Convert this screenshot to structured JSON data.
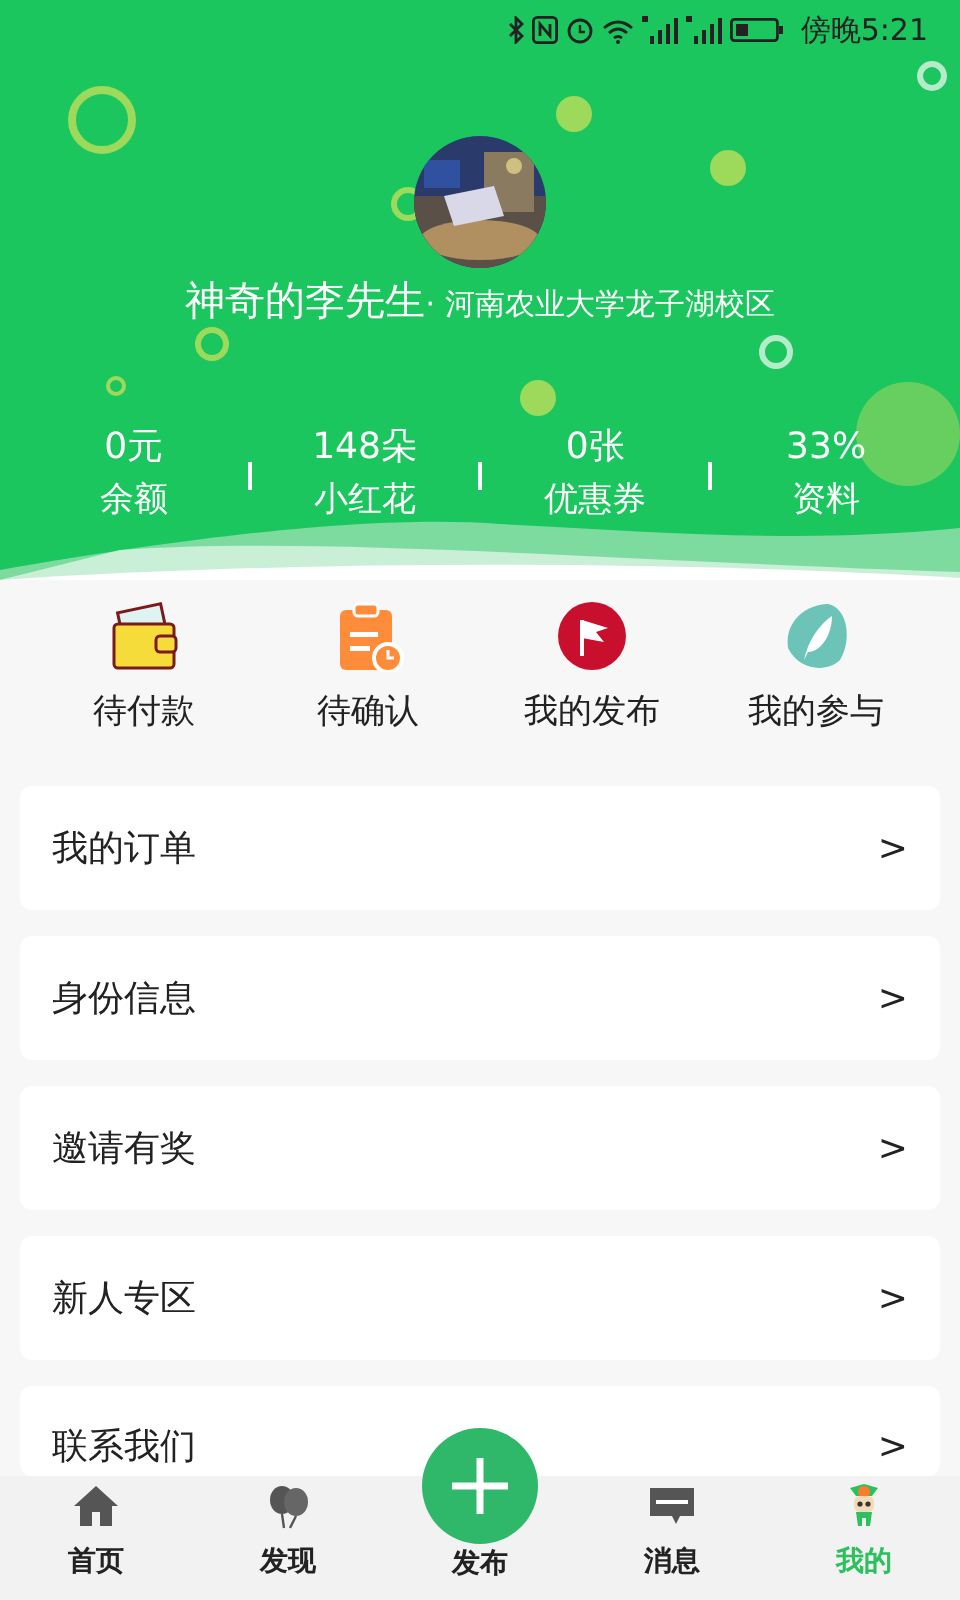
{
  "status_bar": {
    "time": "傍晚5:21"
  },
  "profile": {
    "name": "神奇的李先生",
    "school": "· 河南农业大学龙子湖校区"
  },
  "stats": [
    {
      "value": "0元",
      "label": "余额"
    },
    {
      "value": "148朵",
      "label": "小红花"
    },
    {
      "value": "0张",
      "label": "优惠券"
    },
    {
      "value": "33%",
      "label": "资料"
    }
  ],
  "shortcuts": [
    {
      "kind": "wallet",
      "label": "待付款"
    },
    {
      "kind": "clipboard",
      "label": "待确认"
    },
    {
      "kind": "flag",
      "label": "我的发布"
    },
    {
      "kind": "feather",
      "label": "我的参与"
    }
  ],
  "menu": [
    {
      "label": "我的订单",
      "arrow": ">"
    },
    {
      "label": "身份信息",
      "arrow": ">"
    },
    {
      "label": "邀请有奖",
      "arrow": ">"
    },
    {
      "label": "新人专区",
      "arrow": ">"
    },
    {
      "label": "联系我们",
      "arrow": ">"
    }
  ],
  "tab_bar": [
    {
      "kind": "home",
      "label": "首页",
      "selected": false
    },
    {
      "kind": "balloons",
      "label": "发现",
      "selected": false
    },
    {
      "kind": "publish",
      "label": "发布",
      "selected": false
    },
    {
      "kind": "message",
      "label": "消息",
      "selected": false
    },
    {
      "kind": "mascot",
      "label": "我的",
      "selected": true
    }
  ]
}
